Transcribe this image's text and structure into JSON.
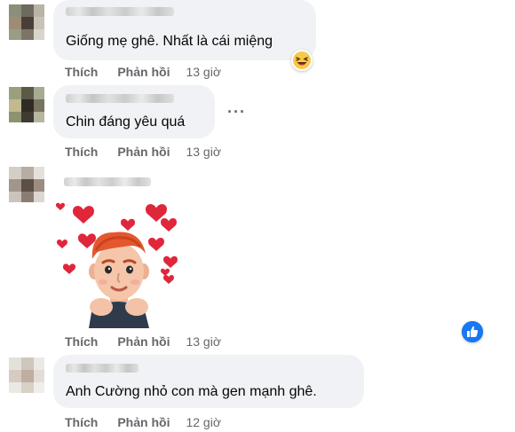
{
  "comments": [
    {
      "text": "Giống mẹ ghê. Nhất là cái miệng",
      "like_label": "Thích",
      "reply_label": "Phản hồi",
      "time": "13 giờ",
      "reaction_icon": "laughing-face-icon"
    },
    {
      "text": "Chin đáng yêu quá",
      "like_label": "Thích",
      "reply_label": "Phản hồi",
      "time": "13 giờ",
      "more_icon": "more-options-icon"
    },
    {
      "sticker": "avatar-sticker-hearts",
      "like_label": "Thích",
      "reply_label": "Phản hồi",
      "time": "13 giờ",
      "reaction_icon": "like-thumb-icon"
    },
    {
      "text": "Anh Cường nhỏ con mà gen mạnh ghê.",
      "like_label": "Thích",
      "reply_label": "Phản hồi",
      "time": "12 giờ"
    }
  ],
  "colors": {
    "bubble": "#f0f2f5",
    "action_text": "#65676b",
    "like_blue": "#1877f2",
    "heart_red": "#e0263b"
  }
}
